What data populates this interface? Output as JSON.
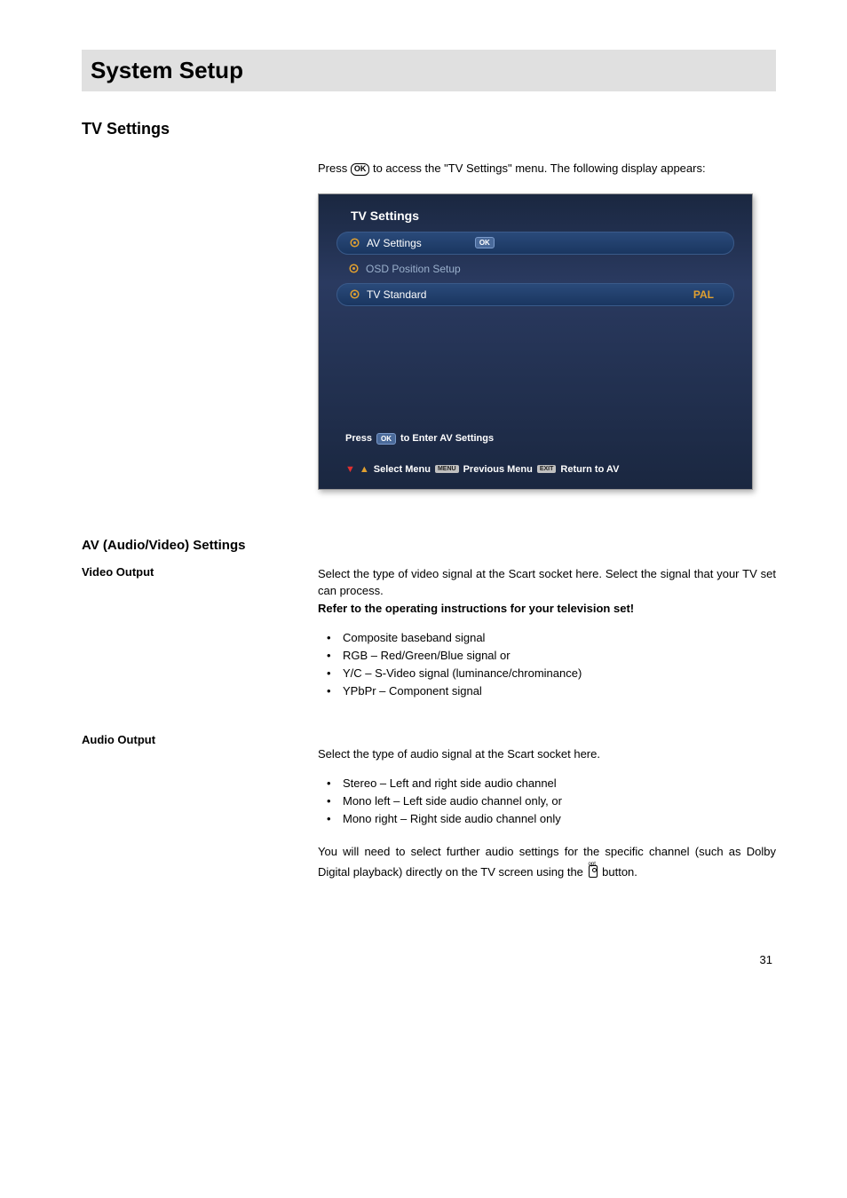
{
  "page_title": "System Setup",
  "section": "TV Settings",
  "intro_before": "Press ",
  "intro_ok": "OK",
  "intro_after": " to access the \"TV Settings\" menu. The following display appears:",
  "screenshot": {
    "title": "TV Settings",
    "row1": "AV Settings",
    "row1_ok": "OK",
    "row2": "OSD Position Setup",
    "row3": "TV Standard",
    "row3_value": "PAL",
    "hint_prefix": "Press",
    "hint_ok": "OK",
    "hint_suffix": "to Enter AV Settings",
    "footer_select": "Select Menu",
    "footer_menu_badge": "MENU",
    "footer_prev": "Previous Menu",
    "footer_exit_badge": "EXIT",
    "footer_return": "Return to AV"
  },
  "av_heading": "AV (Audio/Video) Settings",
  "video_output": {
    "label": "Video Output",
    "para": "Select the type of video signal at the Scart socket here. Select the signal that your TV set can process.",
    "bold": "Refer to the operating instructions for your television set!",
    "items": [
      "Composite baseband signal",
      "RGB – Red/Green/Blue signal or",
      "Y/C – S-Video signal (luminance/chrominance)",
      "YPbPr – Component signal"
    ]
  },
  "audio_output": {
    "label": "Audio Output",
    "para": "Select the type of audio signal at the Scart socket here.",
    "items": [
      "Stereo – Left and right side audio channel",
      "Mono left – Left side audio channel only, or",
      "Mono right – Right side audio channel only"
    ],
    "note_before": "You will need to select further audio settings for the specific channel (such as Dolby Digital playback) directly on the TV screen using the ",
    "note_after": " button."
  },
  "page_number": "31"
}
